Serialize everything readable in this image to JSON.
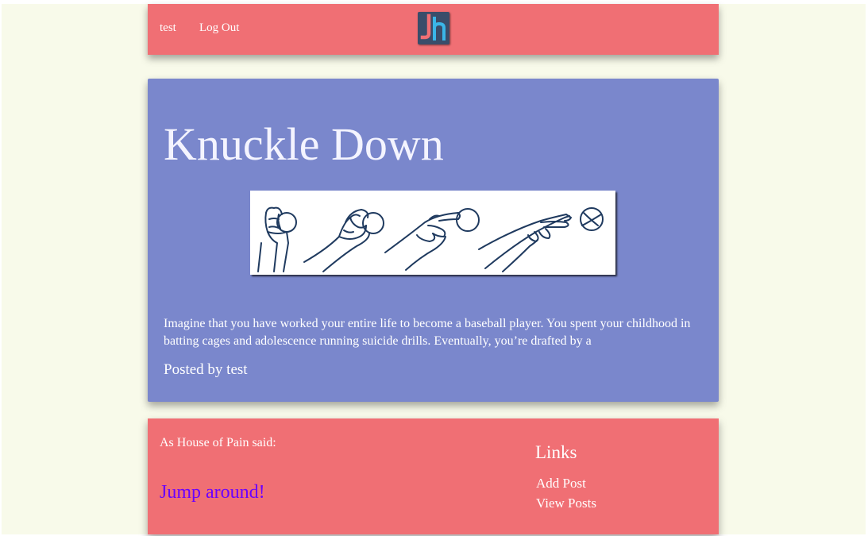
{
  "nav": {
    "user_link": "test",
    "logout_link": "Log Out"
  },
  "logo": {
    "letters": "Jh",
    "colors": {
      "background": "#3a4d6a",
      "j": "#f06f74",
      "h": "#3ab6e8"
    }
  },
  "post": {
    "title": "Knuckle Down",
    "excerpt": "Imagine that you have worked your entire life to become a baseball player. You spent your childhood in batting cages and adolescence running suicide drills. Eventually, you’re drafted by a",
    "byline": "Posted by test"
  },
  "footer": {
    "quote_intro": "As House of Pain said:",
    "quote_link": "Jump around!",
    "links_heading": "Links",
    "links": [
      "Add Post",
      "View Posts"
    ]
  },
  "colors": {
    "page_background": "#f8faea",
    "nav_background": "#f06f74",
    "post_background": "#7a87cc",
    "quote_link": "#6b00ff"
  }
}
